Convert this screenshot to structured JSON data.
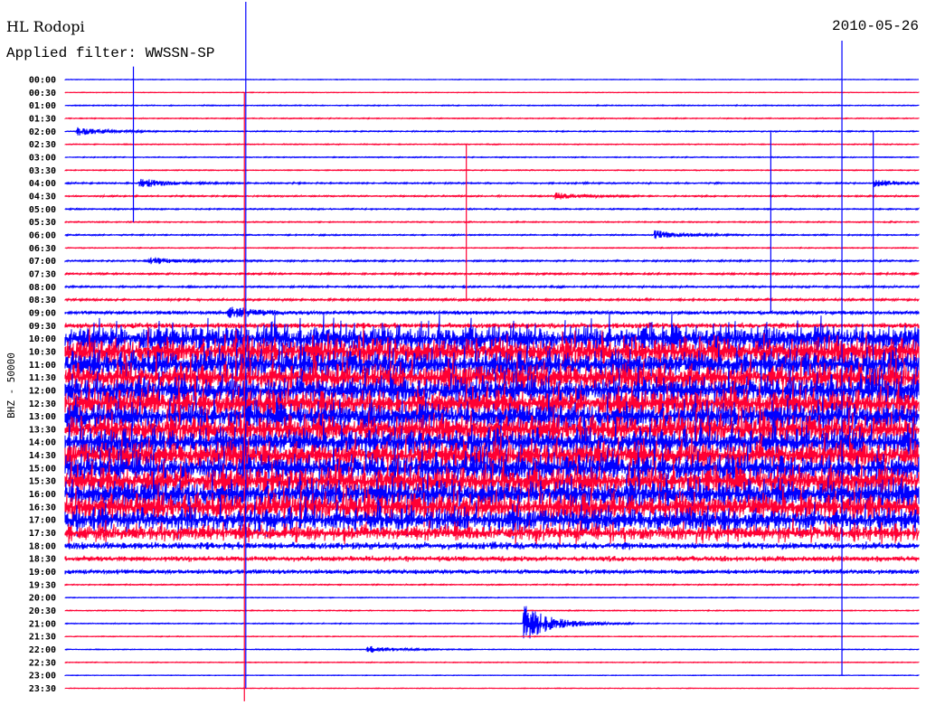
{
  "header": {
    "station": "HL Rodopi",
    "filter": "Applied filter: WWSSN-SP",
    "date": "2010-05-26"
  },
  "chart_data": {
    "type": "line",
    "subtype": "helicorder",
    "ylabel": "BHZ - 50000",
    "minutes_per_line": 30,
    "colors": [
      "#0000ff",
      "#ff0033"
    ],
    "tick_labels": [
      "00:00",
      "00:30",
      "01:00",
      "01:30",
      "02:00",
      "02:30",
      "03:00",
      "03:30",
      "04:00",
      "04:30",
      "05:00",
      "05:30",
      "06:00",
      "06:30",
      "07:00",
      "07:30",
      "08:00",
      "08:30",
      "09:00",
      "09:30",
      "10:00",
      "10:30",
      "11:00",
      "11:30",
      "12:00",
      "12:30",
      "13:00",
      "13:30",
      "14:00",
      "14:30",
      "15:00",
      "15:30",
      "16:00",
      "16:30",
      "17:00",
      "17:30",
      "18:00",
      "18:30",
      "19:00",
      "19:30",
      "20:00",
      "20:30",
      "21:00",
      "21:30",
      "22:00",
      "22:30",
      "23:00",
      "23:30"
    ],
    "noise_level": [
      0.3,
      0.3,
      0.5,
      0.5,
      0.6,
      0.5,
      0.5,
      0.5,
      0.8,
      0.8,
      0.7,
      0.6,
      0.7,
      0.5,
      0.9,
      1.0,
      1.0,
      1.2,
      2.0,
      3.0,
      14,
      14,
      14,
      14,
      14,
      14,
      14,
      14,
      14,
      14,
      14,
      14,
      14,
      14,
      12,
      8,
      4,
      3,
      2.5,
      0.6,
      0.4,
      0.5,
      0.5,
      0.4,
      0.4,
      0.4,
      0.3,
      0.3
    ],
    "events": [
      {
        "row": 4,
        "minute": 0.5,
        "amp": 4
      },
      {
        "row": 8,
        "minute": 2.7,
        "amp": 4
      },
      {
        "row": 8,
        "minute": 28.5,
        "amp": 3
      },
      {
        "row": 9,
        "minute": 17.3,
        "amp": 3
      },
      {
        "row": 12,
        "minute": 20.8,
        "amp": 4
      },
      {
        "row": 14,
        "minute": 3.0,
        "amp": 3
      },
      {
        "row": 18,
        "minute": 5.8,
        "amp": 5
      },
      {
        "row": 42,
        "minute": 16.2,
        "amp": 16
      },
      {
        "row": 44,
        "minute": 10.7,
        "amp": 3
      }
    ],
    "spikes": [
      {
        "row": 0,
        "minute": 6.35,
        "amp": -6,
        "len": 53
      },
      {
        "row": 0,
        "minute": 2.4,
        "amp": -1,
        "len": 12
      },
      {
        "row": 1,
        "minute": 6.3,
        "amp": 0,
        "len": 47
      },
      {
        "row": 0,
        "minute": 27.3,
        "amp": -3,
        "len": 49
      },
      {
        "row": 4,
        "minute": 28.4,
        "amp": 0,
        "len": 20
      },
      {
        "row": 4,
        "minute": 24.8,
        "amp": 0,
        "len": 14
      },
      {
        "row": 5,
        "minute": 14.1,
        "amp": 0,
        "len": 12
      }
    ]
  }
}
